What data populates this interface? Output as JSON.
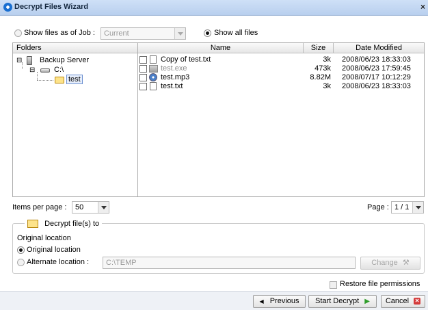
{
  "window": {
    "title": "Decrypt Files Wizard",
    "close_glyph": "×"
  },
  "filter": {
    "show_by_job_label": "Show files as of Job :",
    "job_value": "Current",
    "show_all_label": "Show all files",
    "selected": "show_all"
  },
  "folders": {
    "header": "Folders",
    "tree": [
      {
        "label": "Backup Server",
        "icon": "server-icon",
        "toggle": "⊟"
      },
      {
        "label": "C:\\",
        "icon": "drive-icon",
        "toggle": "⊟"
      },
      {
        "label": "test",
        "icon": "folder-icon",
        "selected": true
      }
    ]
  },
  "files": {
    "columns": [
      "Name",
      "Size",
      "Date Modified"
    ],
    "rows": [
      {
        "name": "Copy of test.txt",
        "size": "3k",
        "date": "2008/06/23 18:33:03",
        "icon": "text-file-icon",
        "dim": false
      },
      {
        "name": "test.exe",
        "size": "473k",
        "date": "2008/06/23 17:59:45",
        "icon": "exe-file-icon",
        "dim": true
      },
      {
        "name": "test.mp3",
        "size": "8.82M",
        "date": "2008/07/17 10:12:29",
        "icon": "audio-file-icon",
        "dim": false
      },
      {
        "name": "test.txt",
        "size": "3k",
        "date": "2008/06/23 18:33:03",
        "icon": "text-file-icon",
        "dim": false
      }
    ]
  },
  "paging": {
    "items_per_page_label": "Items per page :",
    "items_per_page_value": "50",
    "page_label": "Page :",
    "page_value": "1 / 1"
  },
  "decrypt_to": {
    "group_label": "Decrypt file(s) to",
    "current_label": "Original location",
    "original_label": "Original location",
    "alternate_label": "Alternate location :",
    "alternate_value": "C:\\TEMP",
    "change_button": "Change",
    "selected": "original"
  },
  "restore_permissions_label": "Restore file permissions",
  "buttons": {
    "previous": "Previous",
    "start": "Start Decrypt",
    "cancel": "Cancel"
  },
  "colors": {
    "accent_green": "#2e9d2a",
    "cancel_red": "#d43b3b",
    "title_bg": "#c4d8f3"
  }
}
